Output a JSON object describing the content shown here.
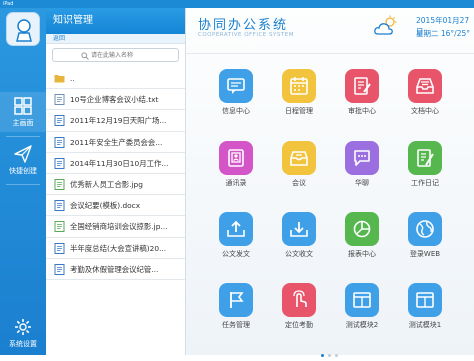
{
  "status_bar": {
    "carrier": "iPad",
    "time": "",
    "battery": ""
  },
  "nav": {
    "items": [
      {
        "label": "主画面",
        "icon": "grid-icon"
      },
      {
        "label": "快捷创建",
        "icon": "send-icon"
      },
      {
        "label": "系统设置",
        "icon": "gear-icon"
      }
    ]
  },
  "file_panel": {
    "title": "知识管理",
    "back_label": "返回",
    "search_placeholder": "请在此输入名称",
    "files": [
      {
        "name": "..",
        "type": "folder"
      },
      {
        "name": "10号企业博客会议小结.txt",
        "type": "txt"
      },
      {
        "name": "2011年12月19日天阳广场...",
        "type": "doc"
      },
      {
        "name": "2011年安全生产委员会会...",
        "type": "doc"
      },
      {
        "name": "2014年11月30日10月工作...",
        "type": "doc"
      },
      {
        "name": "优秀新人员工合影.jpg",
        "type": "jpg"
      },
      {
        "name": "会议纪要(模板).docx",
        "type": "doc"
      },
      {
        "name": "全国经销商培训会议掠影.jp...",
        "type": "jpg"
      },
      {
        "name": "半年度总结(大会宣讲稿)20...",
        "type": "doc"
      },
      {
        "name": "考勤及休假管理会议纪管...",
        "type": "doc"
      }
    ]
  },
  "header": {
    "title": "协同办公系统",
    "subtitle": "COOPERATIVE OFFICE SYSTEM",
    "date": "2015年01月27日",
    "weekday": "星期二  16°/25°",
    "weather_icon": "cloud-sun-icon"
  },
  "apps": [
    {
      "label": "信息中心",
      "color": "#3fa0e8",
      "icon": "message-icon"
    },
    {
      "label": "日程管理",
      "color": "#f2c43e",
      "icon": "calendar-icon"
    },
    {
      "label": "审批中心",
      "color": "#e8556a",
      "icon": "approve-icon"
    },
    {
      "label": "文档中心",
      "color": "#e8556a",
      "icon": "inbox-icon"
    },
    {
      "label": "通讯录",
      "color": "#d455c8",
      "icon": "contacts-icon"
    },
    {
      "label": "会议",
      "color": "#f2c43e",
      "icon": "meeting-icon"
    },
    {
      "label": "华聊",
      "color": "#9b6fe0",
      "icon": "chat-icon"
    },
    {
      "label": "工作日记",
      "color": "#55b74e",
      "icon": "diary-icon"
    },
    {
      "label": "公文发文",
      "color": "#3fa0e8",
      "icon": "upload-icon"
    },
    {
      "label": "公文收文",
      "color": "#3fa0e8",
      "icon": "download-icon"
    },
    {
      "label": "报表中心",
      "color": "#55b74e",
      "icon": "report-icon"
    },
    {
      "label": "登录WEB",
      "color": "#3fa0e8",
      "icon": "globe-icon"
    },
    {
      "label": "任务管理",
      "color": "#3fa0e8",
      "icon": "flag-icon"
    },
    {
      "label": "定位考勤",
      "color": "#e8556a",
      "icon": "touch-icon"
    },
    {
      "label": "测试模块2",
      "color": "#3fa0e8",
      "icon": "window-icon"
    },
    {
      "label": "测试模块1",
      "color": "#3fa0e8",
      "icon": "window-icon"
    }
  ],
  "page_indicator": {
    "pages": 3,
    "current": 1
  }
}
